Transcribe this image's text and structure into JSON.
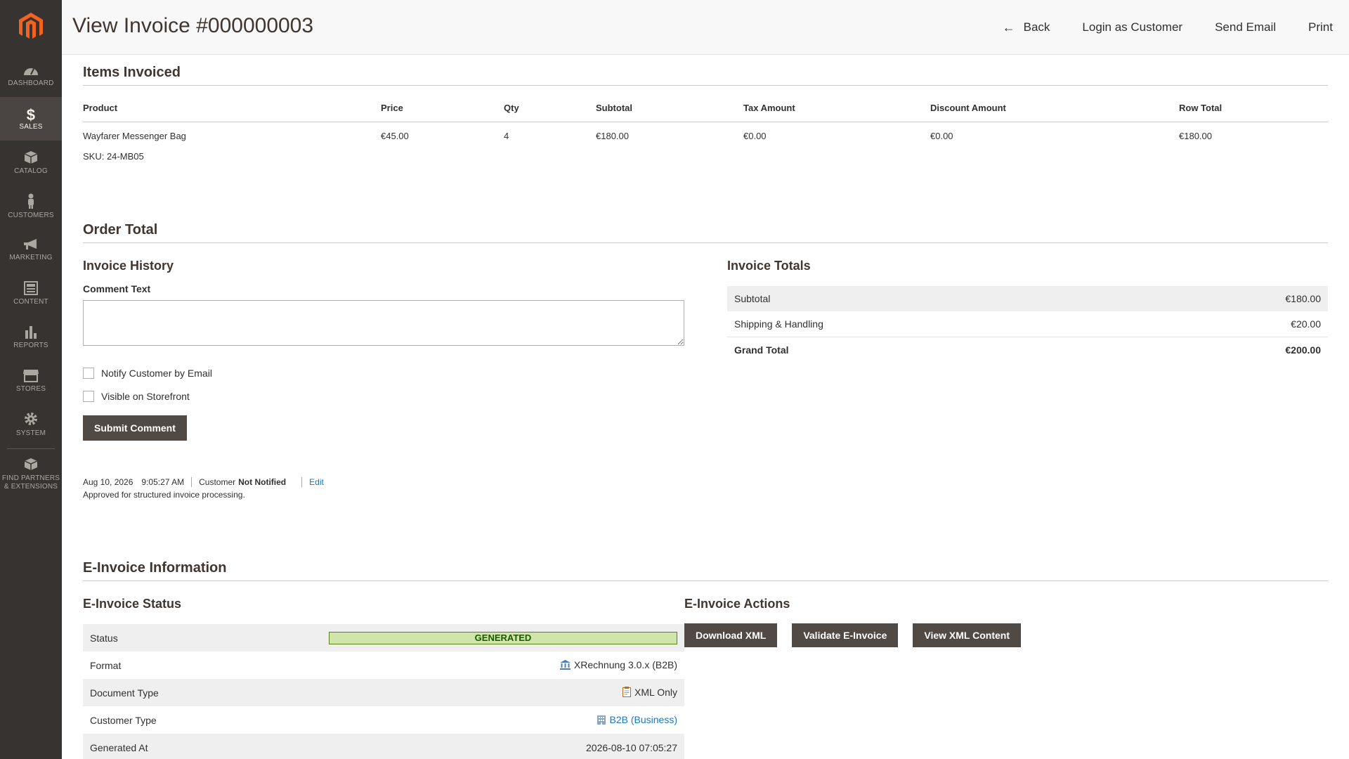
{
  "sidebar": {
    "items": [
      {
        "label": "DASHBOARD",
        "icon": "dashboard-icon"
      },
      {
        "label": "SALES",
        "icon": "dollar-icon",
        "active": true
      },
      {
        "label": "CATALOG",
        "icon": "box-icon"
      },
      {
        "label": "CUSTOMERS",
        "icon": "person-icon"
      },
      {
        "label": "MARKETING",
        "icon": "megaphone-icon"
      },
      {
        "label": "CONTENT",
        "icon": "layout-icon"
      },
      {
        "label": "REPORTS",
        "icon": "bar-chart-icon"
      },
      {
        "label": "STORES",
        "icon": "storefront-icon"
      },
      {
        "label": "SYSTEM",
        "icon": "gear-icon"
      }
    ],
    "partners": {
      "line1": "FIND PARTNERS",
      "line2": "& EXTENSIONS",
      "icon": "boxes-icon"
    }
  },
  "header": {
    "title": "View Invoice #000000003",
    "back": "Back",
    "login_as_customer": "Login as Customer",
    "send_email": "Send Email",
    "print": "Print"
  },
  "items_invoiced": {
    "title": "Items Invoiced",
    "columns": [
      "Product",
      "Price",
      "Qty",
      "Subtotal",
      "Tax Amount",
      "Discount Amount",
      "Row Total"
    ],
    "rows": [
      {
        "product": "Wayfarer Messenger Bag",
        "sku": "SKU: 24-MB05",
        "price": "€45.00",
        "qty": "4",
        "subtotal": "€180.00",
        "tax": "€0.00",
        "discount": "€0.00",
        "row_total": "€180.00"
      }
    ]
  },
  "order_total": {
    "title": "Order Total",
    "history": {
      "title": "Invoice History",
      "comment_label": "Comment Text",
      "comment_value": "",
      "notify_label": "Notify Customer by Email",
      "visible_label": "Visible on Storefront",
      "submit_label": "Submit Comment",
      "entry": {
        "date": "Aug 10, 2026",
        "time": "9:05:27 AM",
        "customer_prefix": "Customer",
        "customer_status": "Not Notified",
        "edit": "Edit",
        "note": "Approved for structured invoice processing."
      }
    },
    "totals": {
      "title": "Invoice Totals",
      "subtotal_label": "Subtotal",
      "subtotal_value": "€180.00",
      "shipping_label": "Shipping & Handling",
      "shipping_value": "€20.00",
      "grand_label": "Grand Total",
      "grand_value": "€200.00"
    }
  },
  "einvoice": {
    "title": "E-Invoice Information",
    "status_title": "E-Invoice Status",
    "rows": {
      "status_label": "Status",
      "status_value": "GENERATED",
      "format_label": "Format",
      "format_value": "XRechnung 3.0.x (B2B)",
      "doctype_label": "Document Type",
      "doctype_value": "XML Only",
      "custtype_label": "Customer Type",
      "custtype_value": "B2B (Business)",
      "generated_label": "Generated At",
      "generated_value": "2026-08-10 07:05:27"
    },
    "actions_title": "E-Invoice Actions",
    "actions": {
      "download": "Download XML",
      "validate": "Validate E-Invoice",
      "view": "View XML Content"
    }
  },
  "colors": {
    "sidebar_bg": "#373330",
    "primary_button": "#514943",
    "status_badge_bg": "#d0e5a9",
    "status_badge_text": "#185b00",
    "link": "#007bdb"
  }
}
